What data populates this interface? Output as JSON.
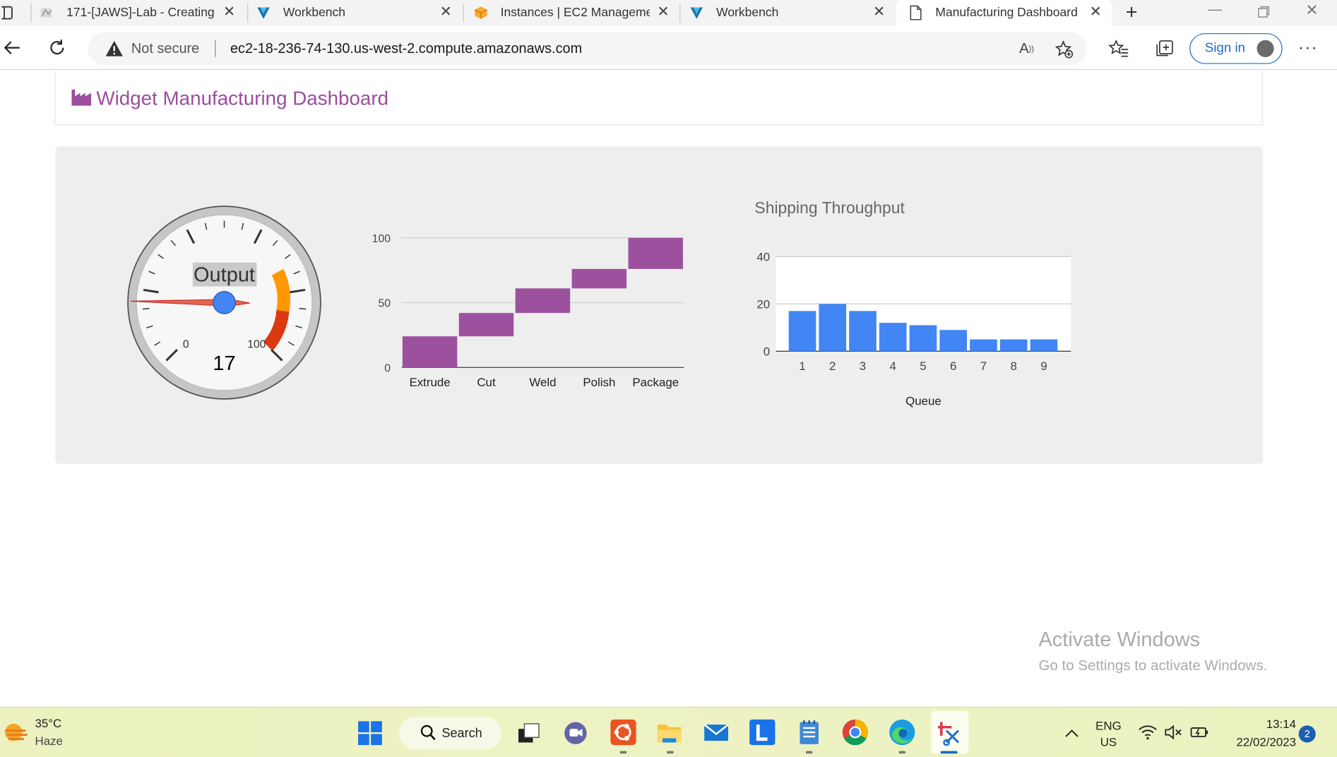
{
  "browser": {
    "tabs": [
      {
        "title": "171-[JAWS]-Lab - Creating",
        "icon": "lab-icon"
      },
      {
        "title": "Workbench",
        "icon": "vocareum-icon"
      },
      {
        "title": "Instances | EC2 Manageme",
        "icon": "aws-icon"
      },
      {
        "title": "Workbench",
        "icon": "vocareum-icon"
      },
      {
        "title": "Manufacturing Dashboard",
        "icon": "page-icon"
      }
    ],
    "security_label": "Not secure",
    "url": "ec2-18-236-74-130.us-west-2.compute.amazonaws.com",
    "signin_label": "Sign in"
  },
  "page": {
    "title": "Widget Manufacturing Dashboard",
    "accent_color": "#9c4d9e"
  },
  "gauge": {
    "label": "Output",
    "value": 17,
    "min_label": "0",
    "max_label": "100",
    "min": 0,
    "max": 100
  },
  "chart_data": [
    {
      "type": "bar",
      "title": "",
      "categories": [
        "Extrude",
        "Cut",
        "Weld",
        "Polish",
        "Package"
      ],
      "ranges": [
        [
          0,
          24
        ],
        [
          24,
          42
        ],
        [
          42,
          61
        ],
        [
          61,
          76
        ],
        [
          76,
          100
        ]
      ],
      "y_ticks": [
        "0",
        "50",
        "100"
      ],
      "ylim": [
        0,
        100
      ],
      "grid": true,
      "color": "#9c519f"
    },
    {
      "type": "bar",
      "title": "Shipping Throughput",
      "xlabel": "Queue",
      "categories": [
        "1",
        "2",
        "3",
        "4",
        "5",
        "6",
        "7",
        "8",
        "9"
      ],
      "values": [
        17,
        20,
        17,
        12,
        11,
        9,
        5,
        5,
        5
      ],
      "y_ticks": [
        "0",
        "20",
        "40"
      ],
      "ylim": [
        0,
        40
      ],
      "grid": true,
      "color": "#4285f4"
    }
  ],
  "watermark": {
    "title": "Activate Windows",
    "subtitle": "Go to Settings to activate Windows."
  },
  "taskbar": {
    "temperature": "35°C",
    "condition": "Haze",
    "search_label": "Search",
    "language": "ENG",
    "region": "US",
    "time": "13:14",
    "date": "22/02/2023",
    "notification_count": "2"
  }
}
